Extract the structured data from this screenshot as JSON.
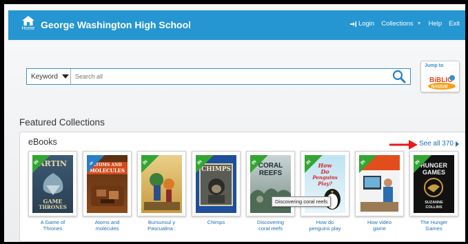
{
  "header": {
    "home_label": "Home",
    "school_name": "George Washington High School",
    "login_label": "Login",
    "collections_label": "Collections",
    "help_label": "Help",
    "exit_label": "Exit",
    "color": "#2596d1"
  },
  "search": {
    "mode": "Keyword",
    "placeholder": "Search all"
  },
  "jump": {
    "label_line1": "Jump to",
    "logo_top": "BiBLIO",
    "logo_bottom": "NASIUM"
  },
  "featured": {
    "heading": "Featured Collections",
    "section_title": "eBooks",
    "see_all": "See all 370"
  },
  "books": [
    {
      "title_line1": "A Game of",
      "title_line2": "Thrones",
      "badge": "IN",
      "cover_lines": [
        "ARTIN",
        "GAME",
        "THRONES"
      ]
    },
    {
      "title_line1": "Atoms and",
      "title_line2": "molecules",
      "badge": "∞",
      "cover_lines": [
        "ATOMS AND",
        "MOLECULES"
      ]
    },
    {
      "title_line1": "Bursunsul y",
      "title_line2": "Pascualina :",
      "badge": "IN",
      "cover_lines": []
    },
    {
      "title_line1": "Chimps",
      "title_line2": "",
      "badge": "IN",
      "cover_lines": [
        "CHIMPS"
      ]
    },
    {
      "title_line1": "Discovering",
      "title_line2": "coral reefs",
      "badge": "IN",
      "cover_lines": [
        "CORAL",
        "REEFS"
      ]
    },
    {
      "title_line1": "How do",
      "title_line2": "penguins play",
      "badge": "IN",
      "cover_lines": [
        "How",
        "Do",
        "Penguins",
        "Play?"
      ]
    },
    {
      "title_line1": "How video",
      "title_line2": "game",
      "badge": "IN",
      "cover_lines": []
    },
    {
      "title_line1": "The Hunger",
      "title_line2": "Games",
      "badge": "IN",
      "cover_lines": [
        "HUNGER",
        "GAMES",
        "SUZANNE",
        "COLLINS"
      ]
    }
  ],
  "tooltip": "Discovering coral reefs",
  "colors": {
    "badge_green": "#33a532",
    "badge_blue": "#2a7fc4",
    "link": "#1f6fb5",
    "arrow": "#e8191a"
  }
}
